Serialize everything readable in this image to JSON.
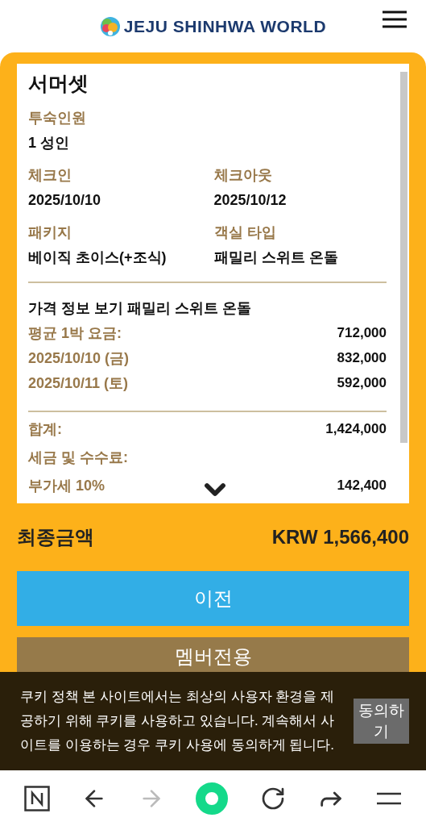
{
  "header": {
    "logo_text": "JEJU SHINHWA WORLD"
  },
  "summary": {
    "title": "서머셋",
    "field_rows": [
      [
        {
          "label": "투숙인원",
          "value": "1 성인"
        }
      ],
      [
        {
          "label": "체크인",
          "value": "2025/10/10"
        },
        {
          "label": "체크아웃",
          "value": "2025/10/12"
        }
      ],
      [
        {
          "label": "패키지",
          "value": "베이직 초이스(+조식)"
        },
        {
          "label": "객실 타입",
          "value": "패밀리 스위트 온돌"
        }
      ]
    ],
    "price_heading": "가격 정보 보기 패밀리 스위트 온돌",
    "price_rows": [
      {
        "label": "평균 1박 요금:",
        "value": "712,000"
      },
      {
        "label": "2025/10/10 (금)",
        "value": "832,000"
      },
      {
        "label": "2025/10/11 (토)",
        "value": "592,000"
      }
    ],
    "total_rows": [
      {
        "label": "합계:",
        "value": "1,424,000"
      },
      {
        "label": "세금 및 수수료:"
      },
      {
        "label": "부가세 10%",
        "value": "142,400"
      }
    ]
  },
  "final": {
    "label": "최종금액",
    "value": "KRW 1,566,400"
  },
  "buttons": [
    {
      "kind": "prev",
      "label": "이전"
    },
    {
      "kind": "member",
      "label": "멤버전용"
    }
  ],
  "cookie_banner": {
    "text": "쿠키 정책 본 사이트에서는 최상의 사용자 환경을 제공하기 위해 쿠키를 사용하고 있습니다. 계속해서 사이트를 이용하는 경우 쿠키 사용에 동의하게 됩니다.",
    "button": "동의하기"
  },
  "browser_bar": {
    "forward_disabled": true
  }
}
